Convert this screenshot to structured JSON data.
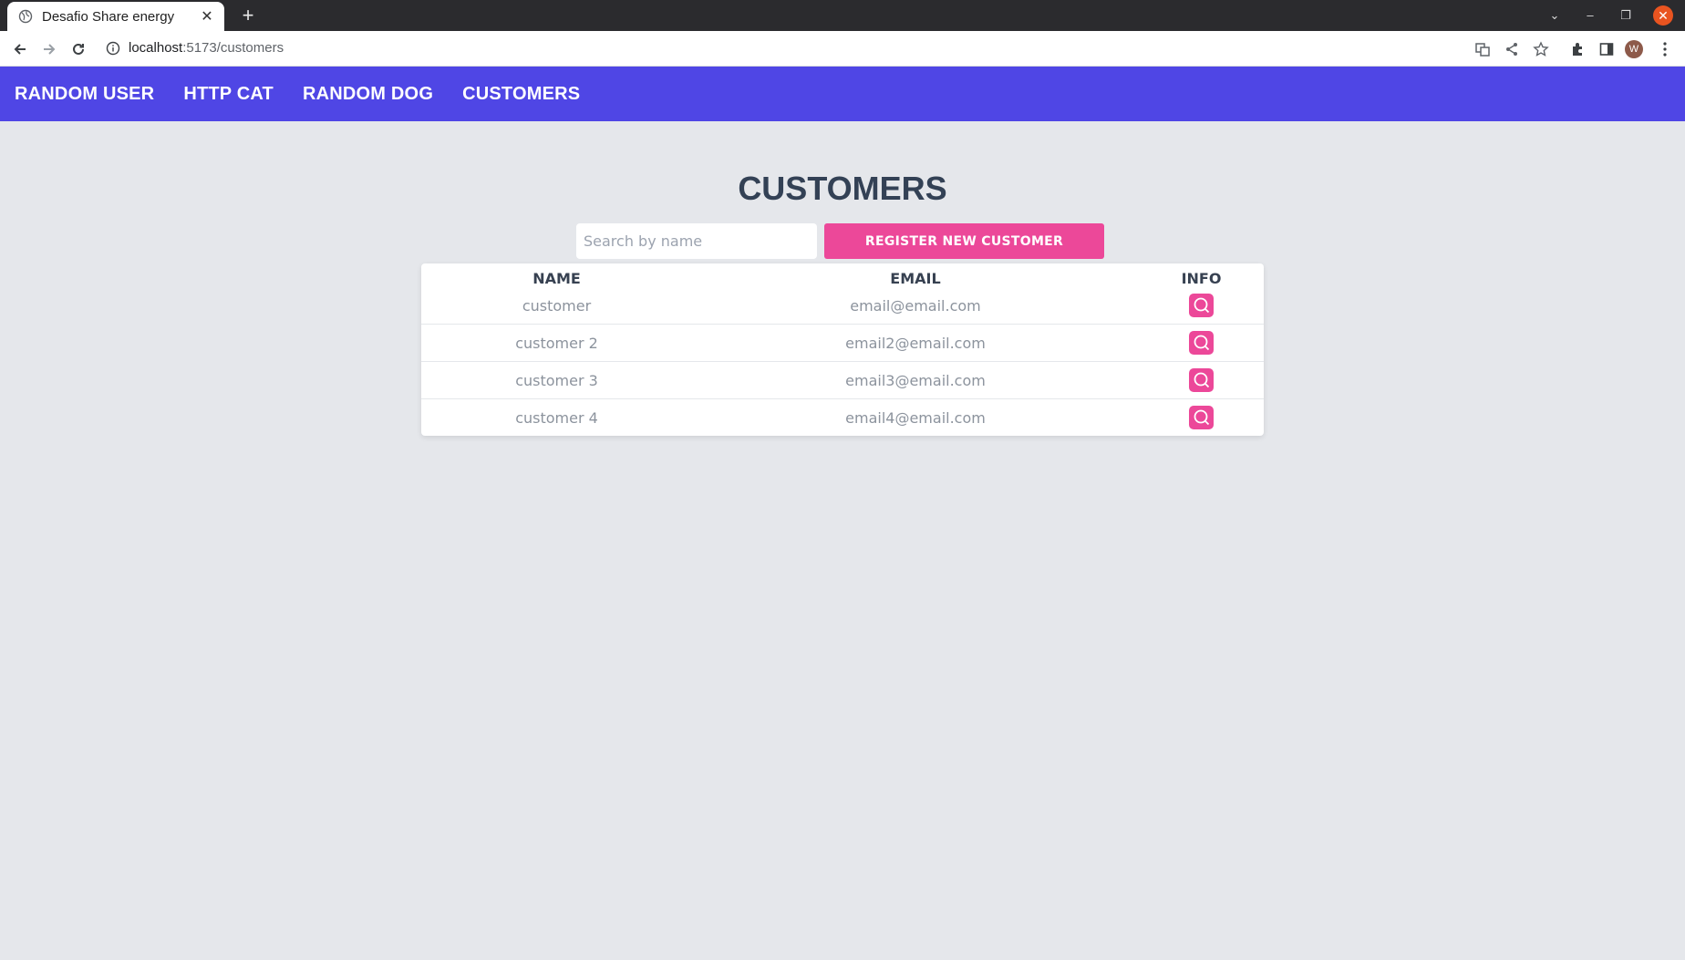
{
  "browser": {
    "tab_title": "Desafio Share energy",
    "url_host": "localhost",
    "url_rest": ":5173/customers",
    "avatar_letter": "W"
  },
  "nav": {
    "items": [
      {
        "label": "RANDOM USER"
      },
      {
        "label": "HTTP CAT"
      },
      {
        "label": "RANDOM DOG"
      },
      {
        "label": "CUSTOMERS"
      }
    ],
    "background": "#4f46e5"
  },
  "page": {
    "title": "CUSTOMERS",
    "search_placeholder": "Search by name",
    "register_label": "REGISTER NEW CUSTOMER",
    "accent": "#ec4899"
  },
  "table": {
    "headers": {
      "name": "NAME",
      "email": "EMAIL",
      "info": "INFO"
    },
    "rows": [
      {
        "name": "customer",
        "email": "email@email.com",
        "info_icon": "search-icon"
      },
      {
        "name": "customer 2",
        "email": "email2@email.com",
        "info_icon": "search-icon"
      },
      {
        "name": "customer 3",
        "email": "email3@email.com",
        "info_icon": "search-icon"
      },
      {
        "name": "customer 4",
        "email": "email4@email.com",
        "info_icon": "search-icon"
      }
    ]
  }
}
